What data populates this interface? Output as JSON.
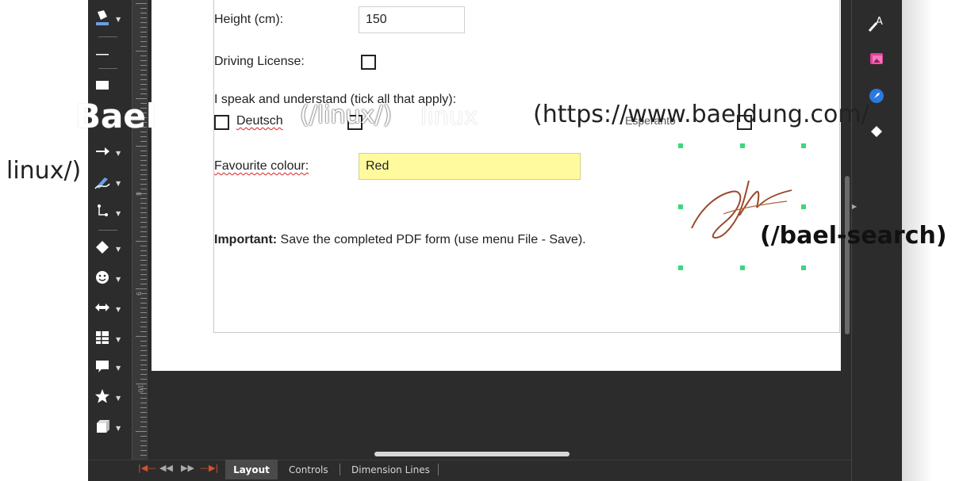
{
  "form": {
    "height_label": "Height (cm):",
    "height_value": "150",
    "license_label": "Driving License:",
    "speak_label": "I speak and understand (tick all that apply):",
    "lang_deutsch": "Deutsch",
    "lang_esperanto": "Esperanto",
    "colour_label": "Favourite colour:",
    "colour_value": "Red",
    "important_bold": "Important:",
    "important_text": " Save the completed PDF form (use menu File - Save)."
  },
  "ruler": {
    "labels": [
      "8",
      "9",
      "10"
    ]
  },
  "tabs": {
    "layout": "Layout",
    "controls": "Controls",
    "dimension_lines": "Dimension Lines"
  },
  "overlay": {
    "brand": "Bael",
    "link_linux": "(/linux/)",
    "linux_logo": "linux",
    "url": "(https://www.baeldung.com/",
    "url_tail": "linux/)",
    "search": "(/bael-search)"
  },
  "icons": {
    "left_toolbar": [
      "fill-color-icon",
      "line-icon",
      "rectangle-icon",
      "arrow-line-icon",
      "curve-icon",
      "connector-icon",
      "diamond-shape-icon",
      "smiley-icon",
      "double-arrow-icon",
      "flowchart-icon",
      "callout-icon",
      "star-icon",
      "3d-cube-icon"
    ],
    "right_bar": [
      "font-effects-icon",
      "gallery-icon",
      "navigator-icon",
      "shapes-icon"
    ]
  },
  "colors": {
    "field_yellow": "#fffa9e",
    "handle_green": "#3fd67a",
    "signature_brown": "#9a4a2a",
    "nav_orange": "#d2532a"
  }
}
